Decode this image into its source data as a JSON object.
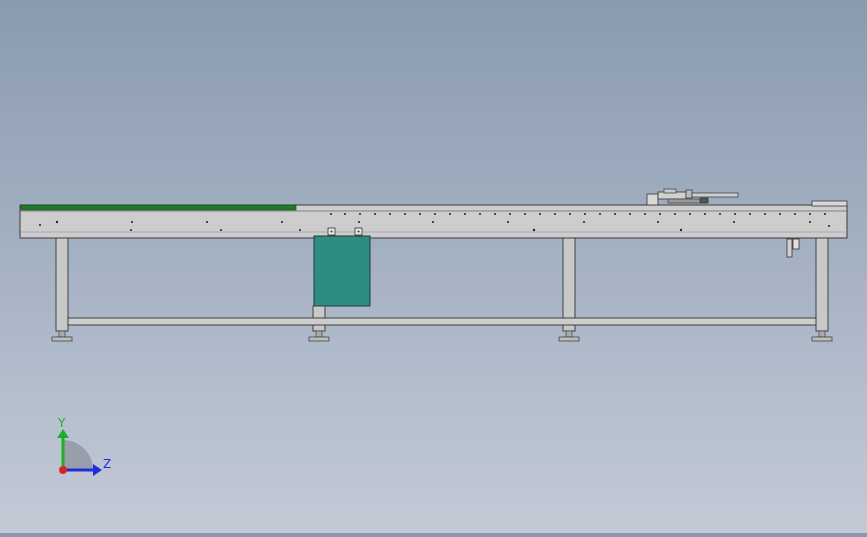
{
  "axis_triad": {
    "y_label": "Y",
    "z_label": "Z",
    "colors": {
      "y": "#1fae2a",
      "z": "#1f2fd6",
      "x": "#e02020"
    }
  },
  "model": {
    "colors": {
      "frame": "#c8c8c8",
      "frame_edge": "#3a3a3a",
      "belt": "#1f7a2a",
      "control_box": "#2f8c80"
    }
  }
}
